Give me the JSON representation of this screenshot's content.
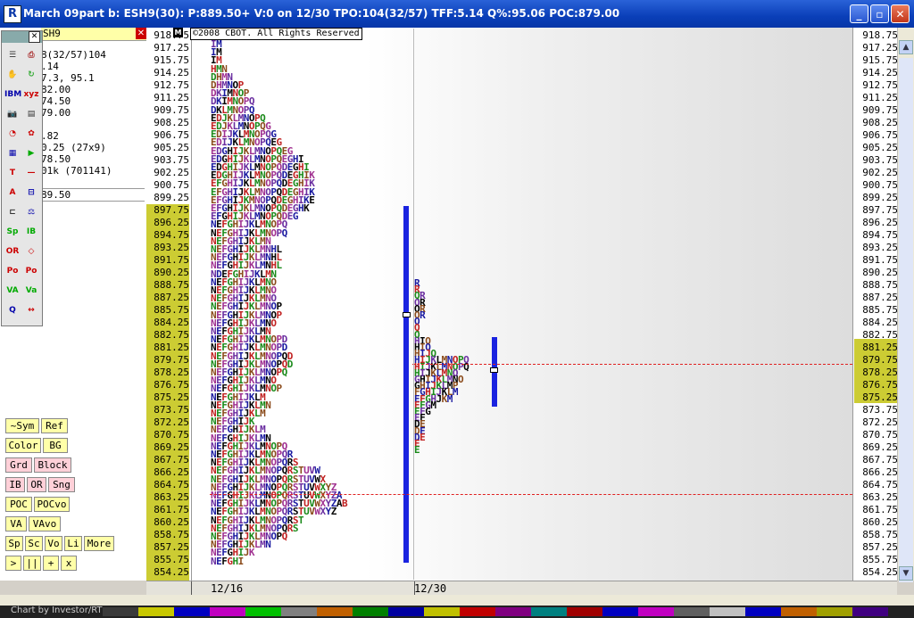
{
  "window": {
    "title": "March 09part b: ESH9(30): P:889.50+ V:0 on 12/30 TPO:104(32/57) TFF:5.14 Q%:95.06 POC:879.00",
    "app_icon": "investor-rt-logo",
    "buttons": [
      "minimize",
      "maximize",
      "close"
    ]
  },
  "info_panel": {
    "symbol": "SH9",
    "lines": [
      "8(32/57)104",
      ".14",
      "7.3, 95.1",
      "82.00",
      "74.50",
      "79.00",
      "",
      ".82",
      "0.25 (27x9)",
      "78.50",
      "01k (701141)",
      "",
      "89.50"
    ]
  },
  "left_prices": [
    "918.75",
    "917.25",
    "915.75",
    "914.25",
    "912.75",
    "911.25",
    "909.75",
    "908.25",
    "906.75",
    "905.25",
    "903.75",
    "902.25",
    "900.75",
    "899.25",
    "897.75",
    "896.25",
    "894.75",
    "893.25",
    "891.75",
    "890.25",
    "888.75",
    "887.25",
    "885.75",
    "884.25",
    "882.75",
    "881.25",
    "879.75",
    "878.25",
    "876.75",
    "875.25",
    "873.75",
    "872.25",
    "870.75",
    "869.25",
    "867.75",
    "866.25",
    "864.75",
    "863.25",
    "861.75",
    "860.25",
    "858.75",
    "857.25",
    "855.75",
    "854.25"
  ],
  "right_prices": [
    "918.75",
    "917.25",
    "915.75",
    "914.25",
    "912.75",
    "911.25",
    "909.75",
    "908.25",
    "906.75",
    "905.25",
    "903.75",
    "902.25",
    "900.75",
    "899.25",
    "897.75",
    "896.25",
    "894.75",
    "893.25",
    "891.75",
    "890.25",
    "888.75",
    "887.25",
    "885.75",
    "884.25",
    "882.75",
    "881.25",
    "879.75",
    "878.25",
    "876.75",
    "875.25",
    "873.75",
    "872.25",
    "870.75",
    "869.25",
    "867.75",
    "866.25",
    "864.75",
    "863.25",
    "861.75",
    "860.25",
    "858.75",
    "857.25",
    "855.75",
    "854.25"
  ],
  "copyright": "©2008 CBOT. All Rights Reserved",
  "dates": [
    "12/16",
    "12/30"
  ],
  "status_text": "Chart by Investor/RT",
  "buttons_panel": [
    [
      "~Sym",
      "Ref"
    ],
    [
      "Color",
      "BG"
    ],
    [
      "Grd",
      "Block"
    ],
    [
      "IB",
      "OR",
      "Sng"
    ],
    [
      "POC",
      "POCvo"
    ],
    [
      "VA",
      "VAvo"
    ],
    [
      "Sp",
      "Sc",
      "Vo",
      "Li",
      "More"
    ],
    [
      ">",
      "||",
      "+",
      "x"
    ]
  ],
  "toolbox_icons": [
    "list-icon",
    "print-icon",
    "hand-icon",
    "refresh-icon",
    "ibm-icon",
    "xyz-icon",
    "camera-icon",
    "notes-icon",
    "pie-icon",
    "color-wheel-icon",
    "grid-icon",
    "play-icon",
    "ts-icon",
    "line-icon",
    "text-icon",
    "ruler-icon",
    "bracket-icon",
    "scale-icon",
    "sp-icon",
    "ib-icon",
    "or-icon",
    "diamond-icon",
    "poc-icon",
    "pocvo-icon",
    "va-icon",
    "vavo-icon",
    "zoom-icon",
    "arrows-icon"
  ],
  "profile1_rows": [
    "IM",
    "IM",
    "IM",
    "HMN",
    "DHMN",
    "DHMN0P",
    "DKIMN0P",
    "DKIMN0PQ",
    "DKLMN0PQ",
    "EDJKLMN0PQ",
    "EDJKLMN0PQ",
    "EDIJKLMN0PQ",
    "EDIJKLMN0PQG",
    "EDGHIJKLMN0PQEG",
    "EDGHIJKLMN0PQEG",
    "EDGHIJKLMNOPQEGHI",
    "EDGHIJKLMNOPQDEGHI",
    "EFGHIJKLMNOPQDEGHIK",
    "EFGHIJKLMNOPQDEGHIK",
    "EFGHIJKMNOPQDEGHIK",
    "EFGHIJKLMNOPQDEGHIK",
    "EFGHIJKLMNOPQDEG",
    "NEFGHIJKLMNOPQ",
    "NEFGHIJKLMNOP",
    "NEFGHIJKLMN",
    "NEFGHIJKLM",
    "NEFGHIJKLMN",
    "NDEFGHIJKL",
    "NEFGHIJKLMN",
    "NEFGHIJKLMNO"
  ],
  "colors": {
    "accent": "#1a23e0",
    "poc_line": "#e02020",
    "highlight": "#cccc33"
  }
}
